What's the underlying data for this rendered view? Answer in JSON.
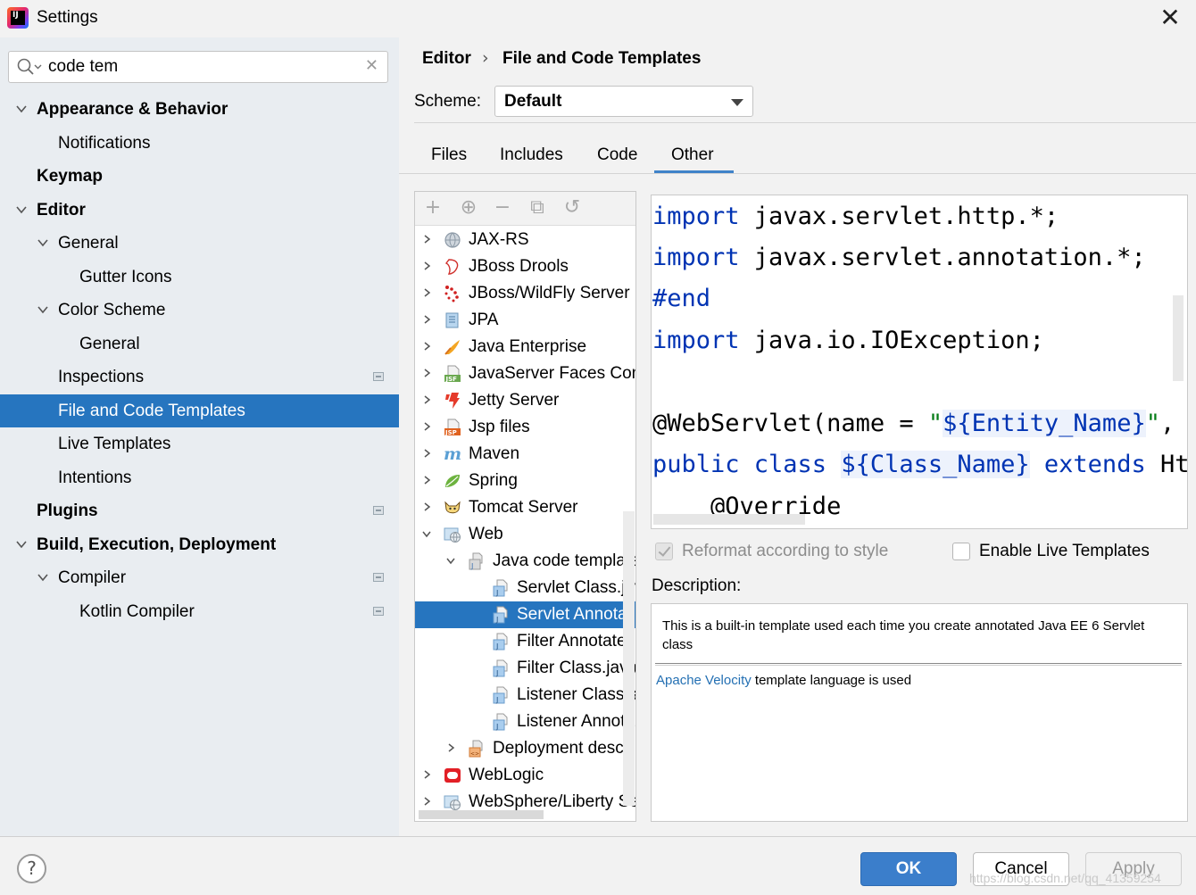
{
  "window": {
    "title": "Settings",
    "close": "✕"
  },
  "search": {
    "value": "code tem",
    "clear": "✕"
  },
  "nav": [
    {
      "label": "Appearance & Behavior",
      "bold": true
    },
    {
      "label": "Notifications"
    },
    {
      "label": "Keymap",
      "bold": true
    },
    {
      "label": "Editor",
      "bold": true
    },
    {
      "label": "General"
    },
    {
      "label": "Gutter Icons"
    },
    {
      "label": "Color Scheme"
    },
    {
      "label": "General"
    },
    {
      "label": "Inspections"
    },
    {
      "label": "File and Code Templates",
      "selected": true
    },
    {
      "label": "Live Templates"
    },
    {
      "label": "Intentions"
    },
    {
      "label": "Plugins",
      "bold": true
    },
    {
      "label": "Build, Execution, Deployment",
      "bold": true
    },
    {
      "label": "Compiler"
    },
    {
      "label": "Kotlin Compiler"
    }
  ],
  "breadcrumb": {
    "parent": "Editor",
    "separator": "›",
    "current": "File and Code Templates"
  },
  "scheme": {
    "label": "Scheme:",
    "value": "Default"
  },
  "tabs": [
    "Files",
    "Includes",
    "Code",
    "Other"
  ],
  "active_tab": "Other",
  "tree_toolbar": {
    "add": "+",
    "add_child": "⊕",
    "remove": "−",
    "copy": "⧉",
    "reset": "↺"
  },
  "tree": [
    {
      "label": "JAX-RS",
      "icon": "globe-icon"
    },
    {
      "label": "JBoss Drools",
      "icon": "drools-icon"
    },
    {
      "label": "JBoss/WildFly Server",
      "icon": "wildfly-icon"
    },
    {
      "label": "JPA",
      "icon": "jpa-icon"
    },
    {
      "label": "Java Enterprise",
      "icon": "java-enterprise-icon"
    },
    {
      "label": "JavaServer Faces Conf",
      "icon": "jsf-icon",
      "badge": "JSF"
    },
    {
      "label": "Jetty Server",
      "icon": "jetty-icon"
    },
    {
      "label": "Jsp files",
      "icon": "jsp-icon",
      "badge": "JSP"
    },
    {
      "label": "Maven",
      "icon": "maven-icon",
      "glyph": "m"
    },
    {
      "label": "Spring",
      "icon": "spring-icon"
    },
    {
      "label": "Tomcat Server",
      "icon": "tomcat-icon"
    },
    {
      "label": "Web",
      "icon": "web-icon"
    },
    {
      "label": "Java code template",
      "icon": "java-template-folder-icon"
    },
    {
      "label": "Servlet Class.jav",
      "icon": "java-file-icon"
    },
    {
      "label": "Servlet Annotat",
      "icon": "java-file-icon",
      "selected": true
    },
    {
      "label": "Filter Annotated",
      "icon": "java-file-icon"
    },
    {
      "label": "Filter Class.java",
      "icon": "java-file-icon"
    },
    {
      "label": "Listener Class.ja",
      "icon": "java-file-icon"
    },
    {
      "label": "Listener Annota",
      "icon": "java-file-icon"
    },
    {
      "label": "Deployment descr",
      "icon": "xml-file-icon"
    },
    {
      "label": "WebLogic",
      "icon": "weblogic-icon"
    },
    {
      "label": "WebSphere/Liberty Se",
      "icon": "websphere-icon"
    }
  ],
  "code": {
    "l1_kw": "import",
    "l1_rest": " javax.servlet.http.*;",
    "l2_kw": "import",
    "l2_rest": " javax.servlet.annotation.*;",
    "l3_dir": "#end",
    "l4_kw": "import",
    "l4_rest": " java.io.IOException;",
    "l5_a": "@WebServlet(name = ",
    "l5_q1": "\"",
    "l5_var": "${Entity_Name}",
    "l5_q2": "\"",
    "l5_b": ", v",
    "l6_kw1": "public class ",
    "l6_var": "${Class_Name}",
    "l6_kw2": " extends ",
    "l6_rest": "Htt",
    "l7": "    @Override"
  },
  "options": {
    "reformat": {
      "label": "Reformat according to style",
      "checked": true,
      "enabled": false
    },
    "live_templates": {
      "label": "Enable Live Templates",
      "checked": false
    }
  },
  "description": {
    "label": "Description:",
    "text": "This is a built-in template used each time you create annotated Java EE 6 Servlet class",
    "link": "Apache Velocity",
    "link_suffix": " template language is used"
  },
  "buttons": {
    "help": "?",
    "ok": "OK",
    "cancel": "Cancel",
    "apply": "Apply"
  },
  "watermark": "https://blog.csdn.net/qq_41359254",
  "colors": {
    "selection": "#2675bf",
    "keyword": "#0033b3",
    "link": "#2470b3",
    "ok": "#3b7ecb"
  }
}
